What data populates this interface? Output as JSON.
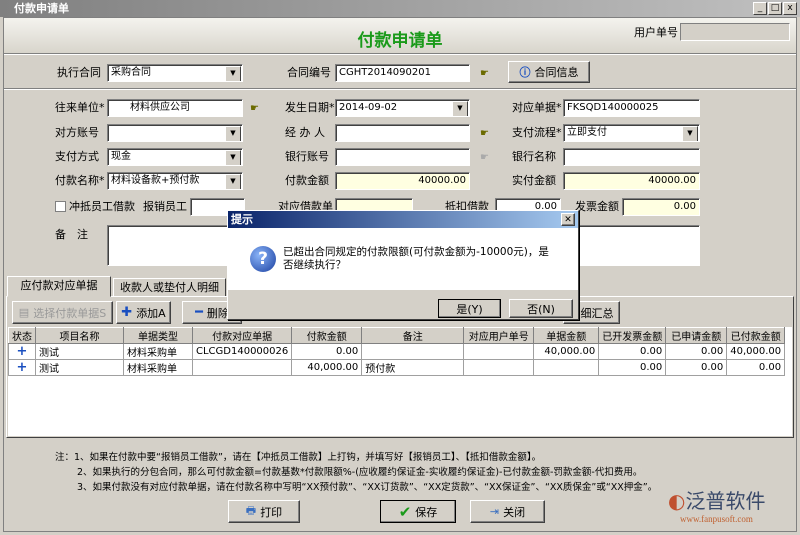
{
  "window": {
    "title": "付款申请单",
    "min": "_",
    "max": "□",
    "close": "x"
  },
  "header": {
    "title": "付款申请单",
    "user_no_label": "用户单号",
    "user_no_value": ""
  },
  "contract": {
    "exec_label": "执行合同",
    "exec_value": "采购合同",
    "no_label": "合同编号",
    "no_value": "CGHT2014090201",
    "info_button": "合同信息"
  },
  "form": {
    "partner_label": "往来单位*",
    "partner_value": "材料供应公司",
    "date_label": "发生日期*",
    "date_value": "2014-09-02",
    "doc_label": "对应单据*",
    "doc_value": "FKSQD140000025",
    "account_label": "对方账号",
    "account_value": "",
    "handler_label": "经 办 人",
    "handler_value": "",
    "flow_label": "支付流程*",
    "flow_value": "立即支付",
    "method_label": "支付方式",
    "method_value": "现金",
    "bank_acct_label": "银行账号",
    "bank_acct_value": "",
    "bank_name_label": "银行名称",
    "bank_name_value": "",
    "pay_name_label": "付款名称*",
    "pay_name_value": "材料设备款+预付款",
    "pay_amount_label": "付款金额",
    "pay_amount_value": "40000.00",
    "actual_label": "实付金额",
    "actual_value": "40000.00",
    "offset_label": "冲抵员工借款",
    "staff_label": "报销员工",
    "staff_value": "",
    "loan_doc_label": "对应借款单",
    "loan_doc_value": "",
    "deduct_label": "抵扣借款",
    "deduct_value": "0.00",
    "invoice_label": "发票金额",
    "invoice_value": "0.00",
    "remark_label": "备　注",
    "remark_value": ""
  },
  "tabs": [
    "应付款对应单据",
    "收款人或垫付人明细"
  ],
  "toolbar": {
    "select": "选择付款单据S",
    "add": "添加A",
    "delete": "删除",
    "summary": "明细汇总"
  },
  "table": {
    "headers": [
      "状态",
      "项目名称",
      "单据类型",
      "付款对应单据",
      "付款金额",
      "备注",
      "对应用户单号",
      "单据金额",
      "已开发票金额",
      "已申请金额",
      "已付款金额"
    ],
    "rows": [
      [
        "+",
        "测试",
        "材料采购单",
        "CLCGD140000026",
        "0.00",
        "",
        "",
        "40,000.00",
        "0.00",
        "0.00",
        "40,000.00"
      ],
      [
        "+",
        "测试",
        "材料采购单",
        "",
        "40,000.00",
        "预付款",
        "",
        "",
        "0.00",
        "0.00",
        "0.00"
      ]
    ]
  },
  "notes": [
    "注：1、如果在付款中要“报销员工借款”，请在【冲抵员工借款】上打钩，并填写好【报销员工】、【抵扣借款金额】。",
    "2、如果执行的分包合同，那么可付款金额=付款基数*付款限额%-(应收履约保证金-实收履约保证金)-已付款金额-罚款金额-代扣费用。",
    "3、如果付款没有对应付款单据，请在付款名称中写明“XX预付款”、“XX订货款”、“XX定货款”、“XX保证金”、“XX质保金”或“XX押金”。"
  ],
  "buttons": {
    "print": "打印",
    "save": "保存",
    "close": "关闭"
  },
  "logo": {
    "name": "泛普软件",
    "url": "www.fanpusoft.com"
  },
  "dialog": {
    "title": "提示",
    "message": "已超出合同规定的付款限额(可付款金额为-10000元)，是否继续执行？",
    "yes": "是(Y)",
    "no": "否(N)"
  }
}
